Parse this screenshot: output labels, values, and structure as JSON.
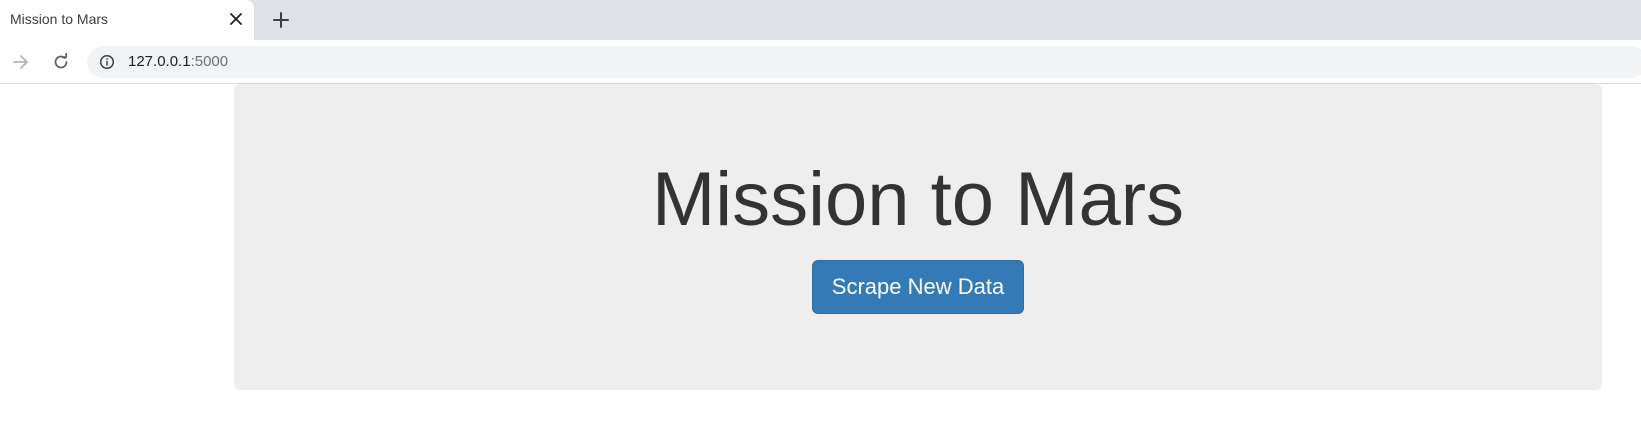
{
  "browser": {
    "tab": {
      "title": "Mission to Mars"
    },
    "address_bar": {
      "host": "127.0.0.1",
      "port": ":5000"
    }
  },
  "page": {
    "heading": "Mission to Mars",
    "scrape_button_label": "Scrape New Data"
  },
  "icons": {
    "close": "close-icon",
    "new_tab": "plus-icon",
    "forward": "arrow-right-icon",
    "reload": "reload-icon",
    "site_info": "info-icon"
  },
  "colors": {
    "tabstrip_bg": "#dee1e6",
    "omnibox_bg": "#f1f3f4",
    "jumbotron_bg": "#eeeeee",
    "heading_text": "#333333",
    "button_bg": "#337ab7",
    "button_border": "#2e6da4"
  }
}
